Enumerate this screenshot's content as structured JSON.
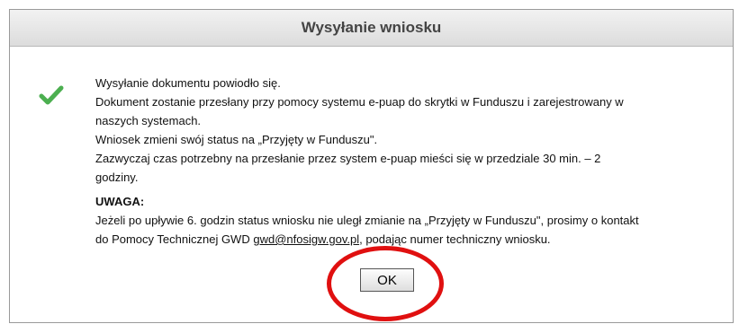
{
  "dialog": {
    "title": "Wysyłanie wniosku",
    "icon": "checkmark-success-icon",
    "success_color": "#4caf50",
    "lines": [
      "Wysyłanie dokumentu powiodło się.",
      "Dokument zostanie przesłany przy pomocy systemu e-puap do skrytki w Funduszu i zarejestrowany w",
      "naszych systemach.",
      "Wniosek zmieni swój status na „Przyjęty w Funduszu\".",
      "Zazwyczaj czas potrzebny na przesłanie przez system e-puap mieści się w przedziale 30 min. – 2",
      "godziny."
    ],
    "warning_title": "UWAGA:",
    "warning_line1": "Jeżeli po upływie 6. godzin status wniosku nie uległ zmianie na „Przyjęty w Funduszu\", prosimy o kontakt",
    "warning_line2_before": "do Pomocy Technicznej GWD ",
    "warning_email": "gwd@nfosigw.gov.pl",
    "warning_line2_after": ", podając numer techniczny wniosku.",
    "ok_label": "OK",
    "highlight_color": "#e01010"
  }
}
